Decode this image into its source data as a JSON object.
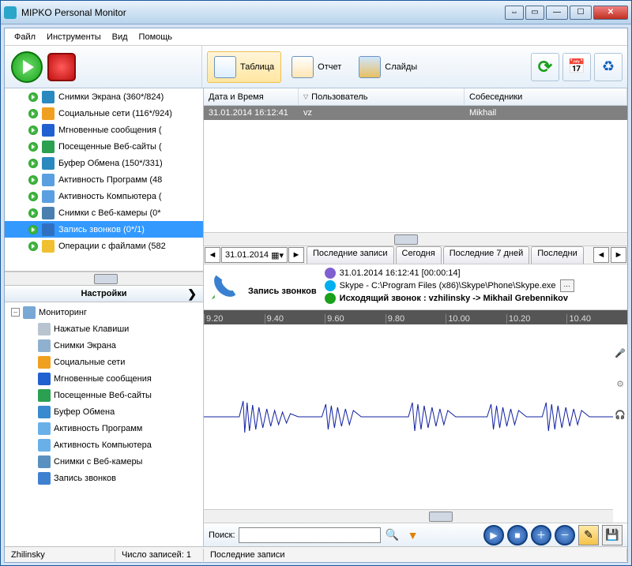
{
  "window": {
    "title": "MIPKO Personal Monitor"
  },
  "menu": {
    "file": "Файл",
    "tools": "Инструменты",
    "view": "Вид",
    "help": "Помощь"
  },
  "viewbar": {
    "table": "Таблица",
    "report": "Отчет",
    "slides": "Слайды"
  },
  "categories": [
    {
      "label": "Снимки Экрана (360*/824)",
      "color": "#2a8ac0"
    },
    {
      "label": "Социальные сети (116*/924)",
      "color": "#f0a020"
    },
    {
      "label": "Мгновенные сообщения (",
      "color": "#2060d0"
    },
    {
      "label": "Посещенные Веб-сайты (",
      "color": "#2aa050"
    },
    {
      "label": "Буфер Обмена (150*/331)",
      "color": "#2a8ac0"
    },
    {
      "label": "Активность Программ (48",
      "color": "#5aa0e0"
    },
    {
      "label": "Активность Компьютера (",
      "color": "#5aa0e0"
    },
    {
      "label": "Снимки с Веб-камеры (0*",
      "color": "#4a80b0"
    },
    {
      "label": "Запись звонков (0*/1)",
      "color": "#3070c0",
      "selected": true
    },
    {
      "label": "Операции с файлами (582",
      "color": "#f0c030"
    }
  ],
  "settings": {
    "title": "Настройки",
    "root": "Мониторинг",
    "items": [
      {
        "label": "Нажатые Клавиши",
        "color": "#b8c4d0"
      },
      {
        "label": "Снимки Экрана",
        "color": "#90b0d0"
      },
      {
        "label": "Социальные сети",
        "color": "#f0a020"
      },
      {
        "label": "Мгновенные сообщения",
        "color": "#2060d0"
      },
      {
        "label": "Посещенные Веб-сайты",
        "color": "#2aa050"
      },
      {
        "label": "Буфер Обмена",
        "color": "#3a8ad0"
      },
      {
        "label": "Активность Программ",
        "color": "#6ab0e8"
      },
      {
        "label": "Активность Компьютера",
        "color": "#6ab0e8"
      },
      {
        "label": "Снимки с Веб-камеры",
        "color": "#5a90c0"
      },
      {
        "label": "Запись звонков",
        "color": "#4080d0"
      }
    ]
  },
  "grid": {
    "cols": {
      "datetime": "Дата и Время",
      "user": "Пользователь",
      "peers": "Собеседники"
    },
    "row": {
      "datetime": "31.01.2014 16:12:41",
      "user": "vz",
      "peers": "Mikhail"
    }
  },
  "dateTabs": {
    "date": "31.01.2014",
    "tabs": [
      "Последние записи",
      "Сегодня",
      "Последние 7 дней",
      "Последни"
    ]
  },
  "details": {
    "title": "Запись звонков",
    "time_line": "31.01.2014 16:12:41 [00:00:14]",
    "app_line": "Skype - C:\\Program Files (x86)\\Skype\\Phone\\Skype.exe",
    "call_line": "Исходящий звонок : vzhilinsky -> Mikhail Grebennikov",
    "ruler": [
      "9.20",
      "9.40",
      "9.60",
      "9.80",
      "10.00",
      "10.20",
      "10.40"
    ]
  },
  "search": {
    "label": "Поиск:",
    "value": ""
  },
  "status": {
    "user": "Zhilinsky",
    "count_label": "Число записей: 1",
    "tab": "Последние записи"
  }
}
